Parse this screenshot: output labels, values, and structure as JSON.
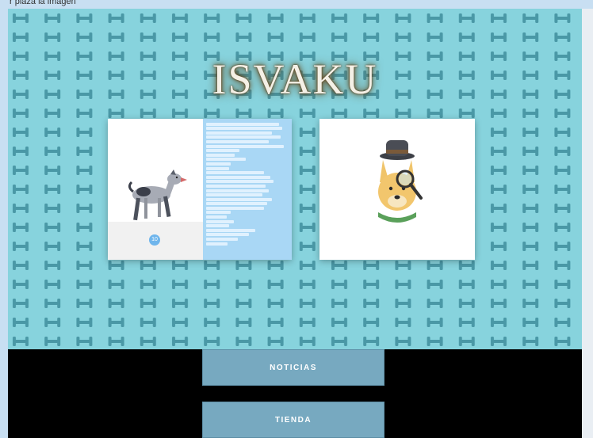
{
  "header": {
    "partial_text": "r plaza la imagen"
  },
  "brand": {
    "title": "ISVAKU"
  },
  "cards": [
    {
      "name": "card-dog-walk",
      "icon": "walking-dog-illustration",
      "badge": "10",
      "list_item_count": 28
    },
    {
      "name": "card-detective-dog",
      "icon": "detective-dog-illustration"
    }
  ],
  "nav": {
    "noticias_label": "NOTICIAS",
    "tienda_label": "TIENDA"
  },
  "colors": {
    "pattern_bg": "#87d3dd",
    "bone": "#4a98a6",
    "nav_button": "#77a9c0",
    "nav_bg": "#000000",
    "list_panel": "#a9d7f5"
  }
}
